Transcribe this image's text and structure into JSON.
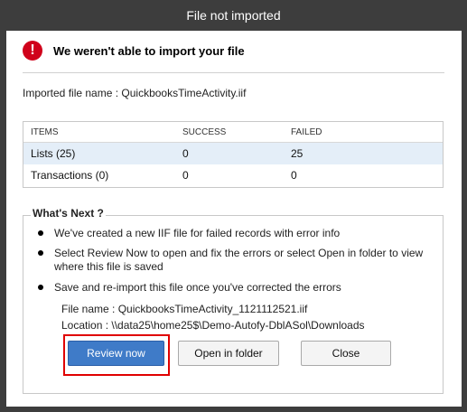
{
  "window": {
    "title": "File not imported"
  },
  "header": {
    "icon": "exclamation-icon",
    "icon_glyph": "!",
    "message": "We weren't able to import your file"
  },
  "file": {
    "label": "Imported file name :",
    "name": "QuickbooksTimeActivity.iif"
  },
  "table": {
    "columns": [
      "ITEMS",
      "SUCCESS",
      "FAILED"
    ],
    "rows": [
      {
        "item": "Lists (25)",
        "success": "0",
        "failed": "25"
      },
      {
        "item": "Transactions (0)",
        "success": "0",
        "failed": "0"
      }
    ]
  },
  "next": {
    "title": "What's Next ?",
    "bullets": [
      "We've created a new IIF file for failed records with error info",
      "Select Review Now to open and fix the errors or select Open in folder to view where this file is saved",
      "Save and re-import this file once you've corrected the errors"
    ],
    "file_name_line": "File name : QuickbooksTimeActivity_1121112521.iif",
    "location_line": "Location  :  \\\\data25\\home25$\\Demo-Autofy-DblASol\\Downloads"
  },
  "buttons": {
    "review": "Review now",
    "open_folder": "Open in folder",
    "close": "Close"
  },
  "colors": {
    "primary": "#3f7bc8",
    "error": "#d0021b",
    "highlight": "#e00000"
  }
}
